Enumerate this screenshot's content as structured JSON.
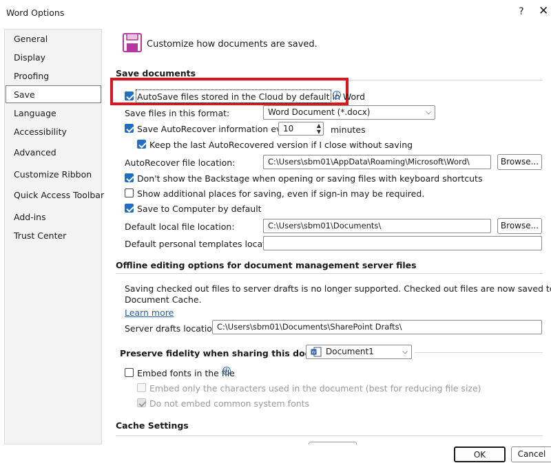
{
  "window": {
    "title": "Word Options",
    "help_label": "?",
    "close_label": "✕"
  },
  "sidebar": {
    "items": [
      {
        "label": "General"
      },
      {
        "label": "Display"
      },
      {
        "label": "Proofing"
      },
      {
        "label": "Save",
        "selected": true
      },
      {
        "label": "Language"
      },
      {
        "label": "Accessibility"
      },
      {
        "label": "Advanced"
      },
      {
        "label": "Customize Ribbon"
      },
      {
        "label": "Quick Access Toolbar"
      },
      {
        "label": "Add-ins"
      },
      {
        "label": "Trust Center"
      }
    ]
  },
  "header": {
    "text": "Customize how documents are saved."
  },
  "save_documents": {
    "title": "Save documents",
    "autosave_label": "AutoSave files stored in the Cloud by default in Word",
    "autosave_checked": true,
    "format_label": "Save files in this format:",
    "format_value": "Word Document (*.docx)",
    "autorecover_label": "Save AutoRecover information every",
    "autorecover_checked": true,
    "autorecover_minutes": "10",
    "minutes_label": "minutes",
    "keep_last_label": "Keep the last AutoRecovered version if I close without saving",
    "keep_last_checked": true,
    "autorecover_location_label": "AutoRecover file location:",
    "autorecover_location_value": "C:\\Users\\sbm01\\AppData\\Roaming\\Microsoft\\Word\\",
    "browse_label": "Browse...",
    "dont_show_backstage_label": "Don't show the Backstage when opening or saving files with keyboard shortcuts",
    "dont_show_backstage_checked": true,
    "show_additional_label": "Show additional places for saving, even if sign-in may be required.",
    "show_additional_checked": false,
    "save_to_computer_label": "Save to Computer by default",
    "save_to_computer_checked": true,
    "default_local_label": "Default local file location:",
    "default_local_value": "C:\\Users\\sbm01\\Documents\\",
    "default_templates_label": "Default personal templates location:",
    "default_templates_value": ""
  },
  "offline": {
    "title": "Offline editing options for document management server files",
    "description_line1": "Saving checked out files to server drafts is no longer supported. Checked out files are now saved to the Office",
    "description_line2": "Document Cache.",
    "learn_more": "Learn more",
    "server_drafts_label": "Server drafts location:",
    "server_drafts_value": "C:\\Users\\sbm01\\Documents\\SharePoint Drafts\\"
  },
  "fidelity": {
    "title": "Preserve fidelity when sharing this document:",
    "document_value": "Document1",
    "embed_fonts_label": "Embed fonts in the file",
    "embed_fonts_checked": false,
    "embed_only_label": "Embed only the characters used in the document (best for reducing file size)",
    "do_not_embed_label": "Do not embed common system fonts"
  },
  "cache": {
    "title": "Cache Settings"
  },
  "footer": {
    "ok_label": "OK",
    "cancel_label": "Cancel"
  },
  "colors": {
    "accent": "#1f6fc5",
    "highlight": "#e0141f",
    "save_icon": "#b3379f"
  }
}
